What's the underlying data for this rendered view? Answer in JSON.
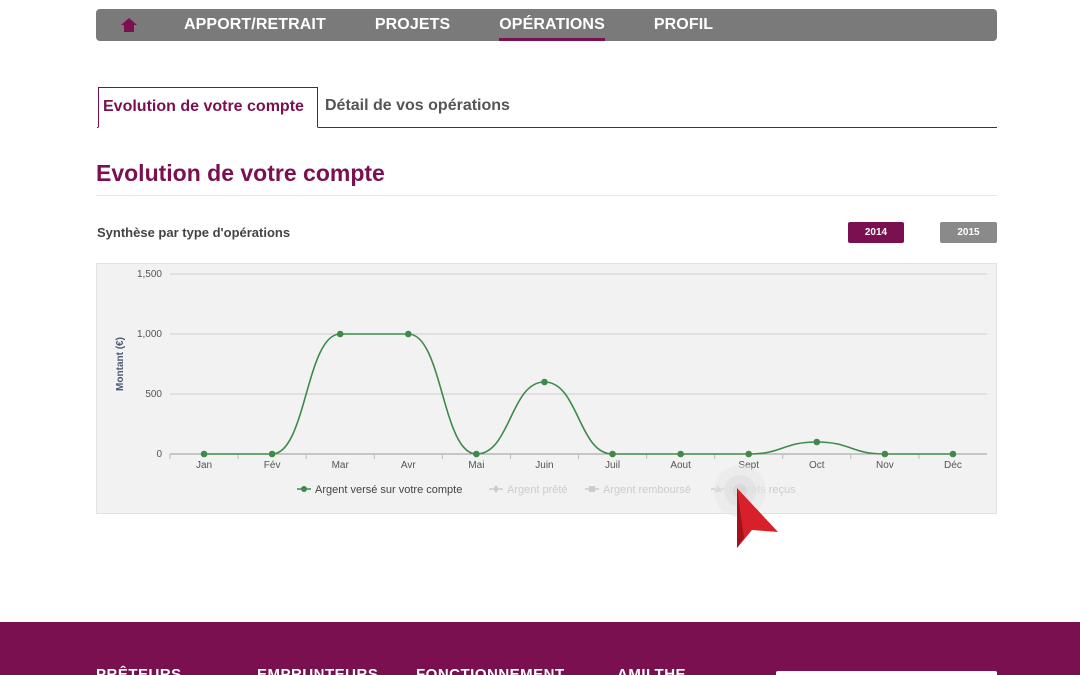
{
  "nav": {
    "items": [
      {
        "label": "APPORT/RETRAIT"
      },
      {
        "label": "PROJETS"
      },
      {
        "label": "OPÉRATIONS"
      },
      {
        "label": "PROFIL"
      }
    ],
    "active": "OPÉRATIONS"
  },
  "tabs": {
    "evolution": "Evolution de votre compte",
    "detail": "Détail de vos opérations"
  },
  "section": {
    "title": "Evolution de votre compte",
    "subtitle": "Synthèse par type d'opérations",
    "year_2014": "2014",
    "year_2015": "2015"
  },
  "colors": {
    "brand": "#7a1050",
    "series": "#3f8a4a",
    "legend_inactive": "#cccccc"
  },
  "chart_data": {
    "type": "line",
    "categories": [
      "Jan",
      "Fév",
      "Mar",
      "Avr",
      "Mai",
      "Juin",
      "Juil",
      "Aout",
      "Sept",
      "Oct",
      "Nov",
      "Déc"
    ],
    "ylabel": "Montant (€)",
    "ylim": [
      0,
      1500
    ],
    "yticks": [
      0,
      500,
      1000,
      1500
    ],
    "ytick_labels": [
      "0",
      "500",
      "1,000",
      "1,500"
    ],
    "grid": true,
    "legend_position": "bottom-center",
    "series": [
      {
        "name": "Argent versé sur votre compte",
        "values": [
          0,
          0,
          1000,
          1000,
          0,
          600,
          0,
          0,
          0,
          100,
          0,
          0
        ],
        "visible": true
      },
      {
        "name": "Argent prêté",
        "values": [],
        "visible": false
      },
      {
        "name": "Argent remboursé",
        "values": [],
        "visible": false
      },
      {
        "name": "Intérêts reçus",
        "values": [],
        "visible": false
      }
    ]
  },
  "footer": {
    "items": [
      {
        "label": "PRÊTEURS"
      },
      {
        "label": "EMPRUNTEURS"
      },
      {
        "label": "FONCTIONNEMENT"
      },
      {
        "label": "AMILTHE"
      }
    ]
  }
}
